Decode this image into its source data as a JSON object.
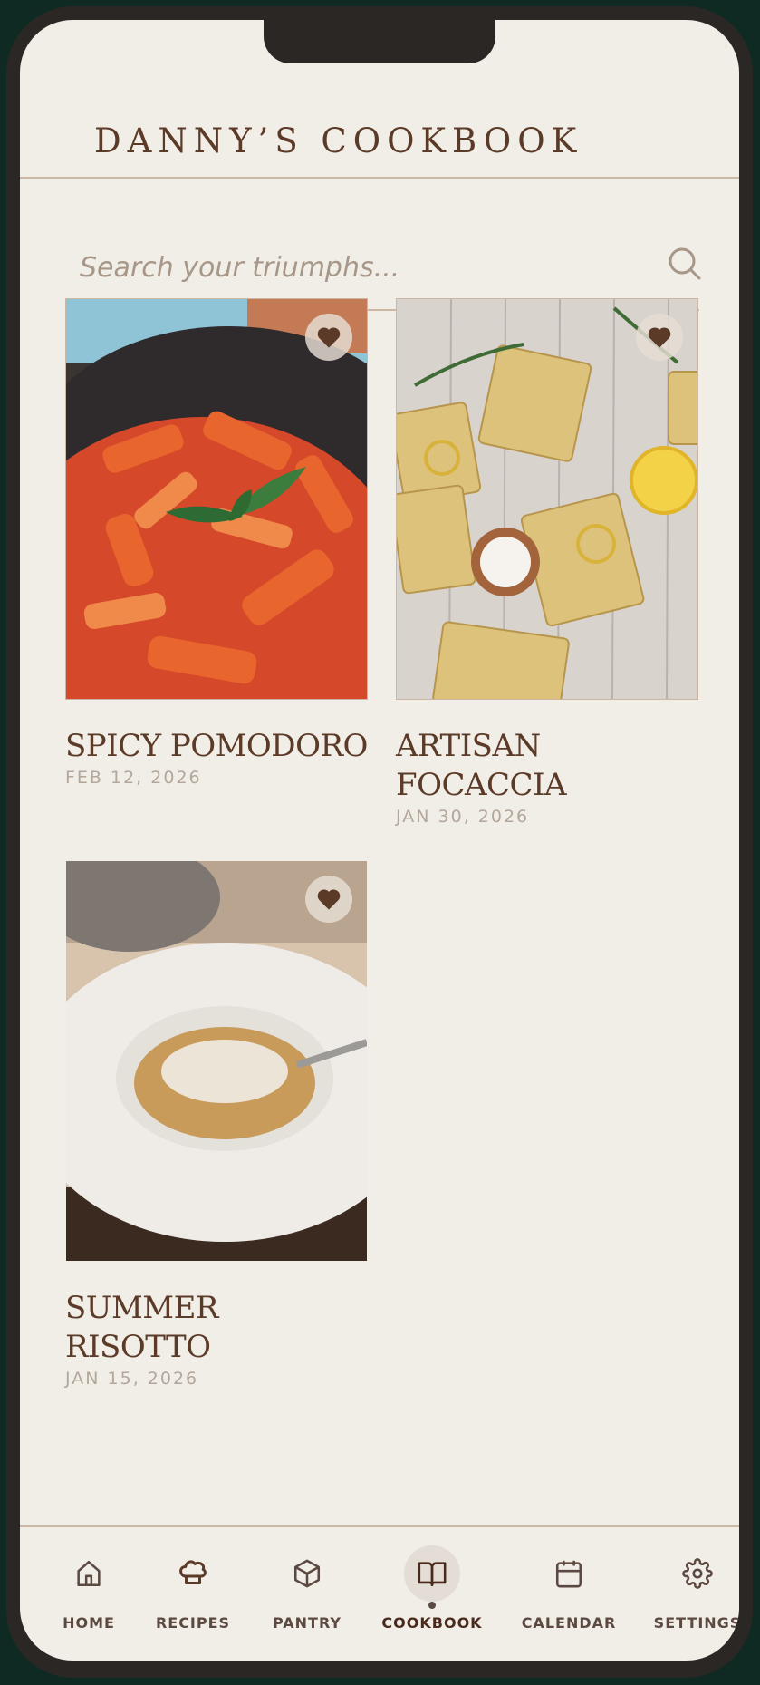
{
  "app": {
    "title": "DANNY’S COOKBOOK"
  },
  "search": {
    "placeholder": "Search your triumphs..."
  },
  "recipes": [
    {
      "title": "SPICY POMODORO",
      "date": "FEB 12, 2026",
      "favorite": true
    },
    {
      "title": "ARTISAN FOCACCIA",
      "date": "JAN 30, 2026",
      "favorite": true
    },
    {
      "title": "SUMMER RISOTTO",
      "date": "JAN 15, 2026",
      "favorite": true
    }
  ],
  "nav": {
    "items": [
      {
        "label": "HOME",
        "icon": "home-icon"
      },
      {
        "label": "RECIPES",
        "icon": "chef-hat-icon"
      },
      {
        "label": "PANTRY",
        "icon": "box-icon"
      },
      {
        "label": "COOKBOOK",
        "icon": "book-open-icon",
        "active": true
      },
      {
        "label": "CALENDAR",
        "icon": "calendar-icon"
      },
      {
        "label": "SETTINGS",
        "icon": "gear-icon"
      }
    ]
  },
  "colors": {
    "accent": "#5c3a28",
    "background": "#f1ede7",
    "divider": "#cdb7a3"
  }
}
